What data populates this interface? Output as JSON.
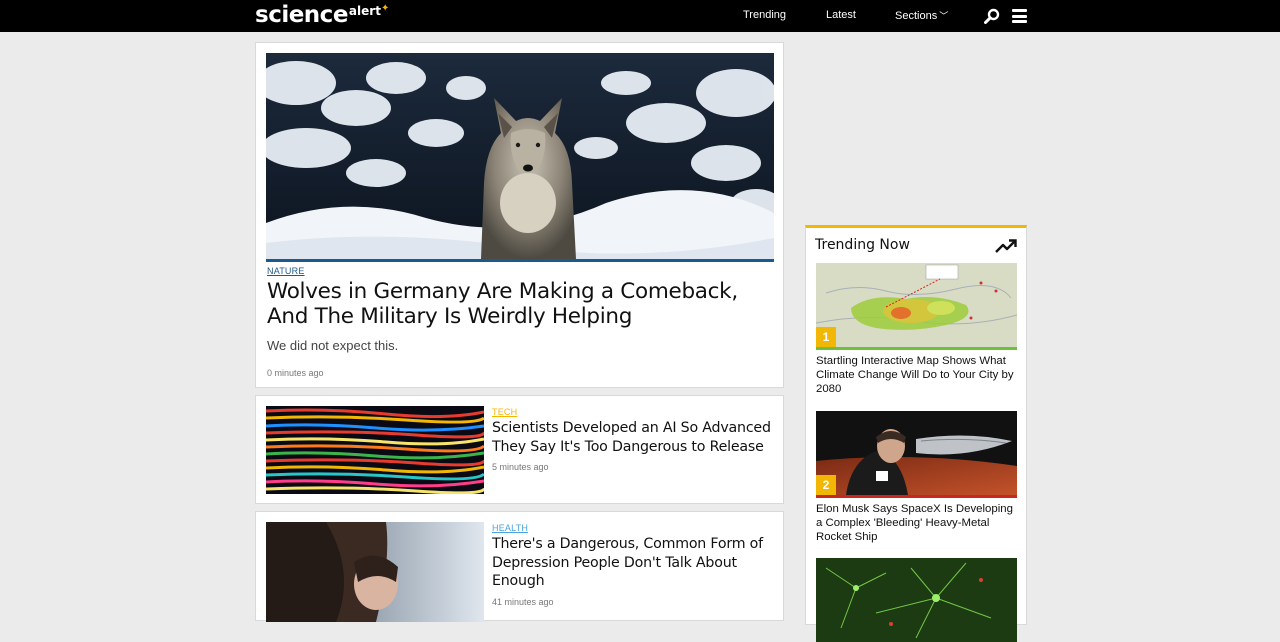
{
  "header": {
    "logo_main": "science",
    "logo_sub": "alert",
    "nav": [
      "Trending",
      "Latest",
      "Sections"
    ]
  },
  "featured": {
    "category": "NATURE",
    "headline": "Wolves in Germany Are Making a Comeback, And The Military Is Weirdly Helping",
    "dek": "We did not expect this.",
    "time": "0 minutes ago"
  },
  "articles": [
    {
      "category": "TECH",
      "headline": "Scientists Developed an AI So Advanced They Say It's Too Dangerous to Release",
      "time": "5 minutes ago"
    },
    {
      "category": "HEALTH",
      "headline": "There's a Dangerous, Common Form of Depression People Don't Talk About Enough",
      "time": "41 minutes ago"
    }
  ],
  "trending": {
    "title": "Trending Now",
    "items": [
      {
        "rank": "1",
        "headline": "Startling Interactive Map Shows What Climate Change Will Do to Your City by 2080"
      },
      {
        "rank": "2",
        "headline": "Elon Musk Says SpaceX Is Developing a Complex 'Bleeding' Heavy-Metal Rocket Ship"
      }
    ]
  },
  "colors": {
    "nature": "#1d5a8c",
    "tech": "#f2b705",
    "health": "#4aa3df",
    "accent": "#f2b705"
  },
  "icons": [
    "search-icon",
    "menu-icon",
    "chevron-down-icon",
    "trending-up-icon"
  ]
}
